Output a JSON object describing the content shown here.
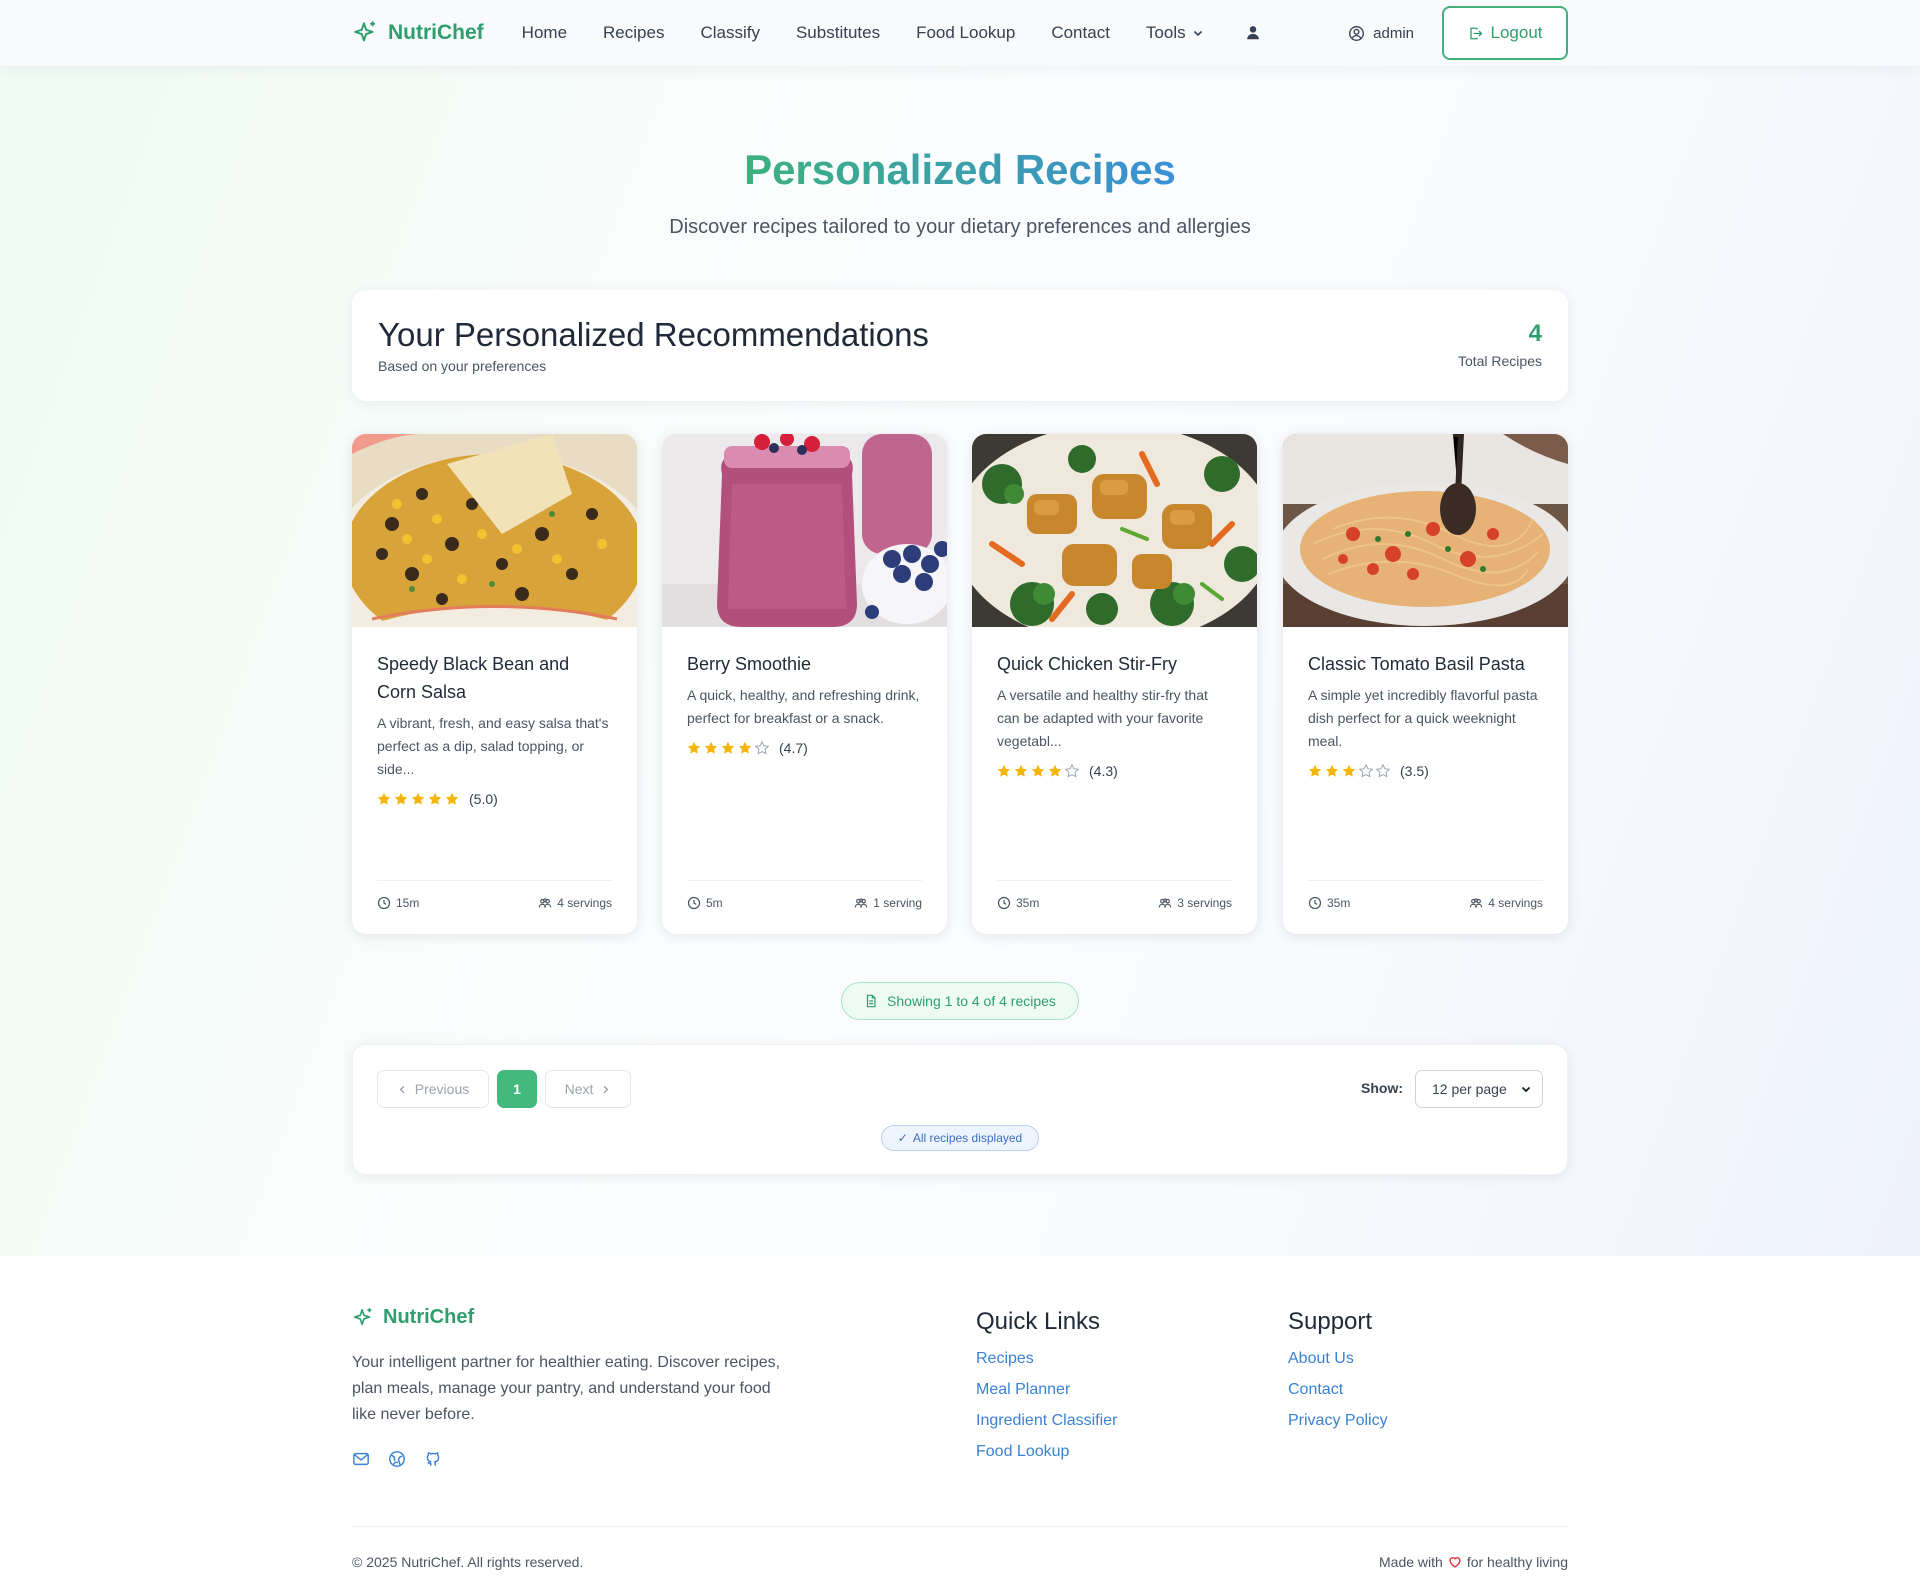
{
  "nav": {
    "brand": "NutriChef",
    "links": [
      "Home",
      "Recipes",
      "Classify",
      "Substitutes",
      "Food Lookup",
      "Contact",
      "Tools"
    ],
    "user": "admin",
    "logout": "Logout"
  },
  "hero": {
    "title": "Personalized Recipes",
    "subtitle": "Discover recipes tailored to your dietary preferences and allergies"
  },
  "recommendations": {
    "title": "Your Personalized Recommendations",
    "subtitle": "Based on your preferences",
    "total": "4",
    "total_label": "Total Recipes"
  },
  "recipes": [
    {
      "title": "Speedy Black Bean and Corn Salsa",
      "description": "A vibrant, fresh, and easy salsa that's perfect as a dip, salad topping, or side...",
      "rating": 5.0,
      "rating_text": "(5.0)",
      "time": "15m",
      "servings": "4 servings",
      "image": "black-bean-corn-salsa"
    },
    {
      "title": "Berry Smoothie",
      "description": "A quick, healthy, and refreshing drink, perfect for breakfast or a snack.",
      "rating": 4.7,
      "rating_text": "(4.7)",
      "time": "5m",
      "servings": "1 serving",
      "image": "berry-smoothie"
    },
    {
      "title": "Quick Chicken Stir-Fry",
      "description": "A versatile and healthy stir-fry that can be adapted with your favorite vegetabl...",
      "rating": 4.3,
      "rating_text": "(4.3)",
      "time": "35m",
      "servings": "3 servings",
      "image": "chicken-stir-fry"
    },
    {
      "title": "Classic Tomato Basil Pasta",
      "description": "A simple yet incredibly flavorful pasta dish perfect for a quick weeknight meal.",
      "rating": 3.5,
      "rating_text": "(3.5)",
      "time": "35m",
      "servings": "4 servings",
      "image": "tomato-basil-pasta"
    }
  ],
  "showing": "Showing 1 to 4 of 4 recipes",
  "pagination": {
    "previous": "Previous",
    "current": "1",
    "next": "Next",
    "show_label": "Show:",
    "per_page": "12 per page",
    "all_displayed": "All recipes displayed"
  },
  "footer": {
    "brand": "NutriChef",
    "description": "Your intelligent partner for healthier eating. Discover recipes, plan meals, manage your pantry, and understand your food like never before.",
    "quick_links_title": "Quick Links",
    "quick_links": [
      "Recipes",
      "Meal Planner",
      "Ingredient Classifier",
      "Food Lookup"
    ],
    "support_title": "Support",
    "support_links": [
      "About Us",
      "Contact",
      "Privacy Policy"
    ],
    "copyright": "© 2025 NutriChef. All rights reserved.",
    "made_with_prefix": "Made with",
    "made_with_suffix": "for healthy living"
  },
  "colors": {
    "brand_green": "#2f9e6e",
    "accent_green": "#43b97d",
    "link_blue": "#3a82d4",
    "star": "#f5b50a"
  }
}
